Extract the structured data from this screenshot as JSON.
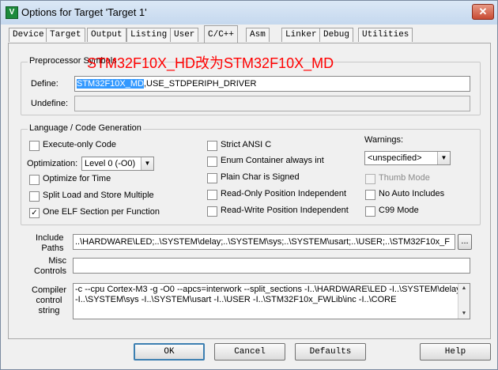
{
  "window": {
    "title": "Options for Target 'Target 1'",
    "app_icon_glyph": "V",
    "close_glyph": "✕"
  },
  "tabs": [
    {
      "label": "Device"
    },
    {
      "label": "Target"
    },
    {
      "label": "Output"
    },
    {
      "label": "Listing"
    },
    {
      "label": "User"
    },
    {
      "label": "C/C++"
    },
    {
      "label": "Asm"
    },
    {
      "label": "Linker"
    },
    {
      "label": "Debug"
    },
    {
      "label": "Utilities"
    }
  ],
  "annotation": "STM32F10X_HD改为STM32F10X_MD",
  "preprocessor": {
    "legend": "Preprocessor Symbols",
    "define_label": "Define:",
    "define_selected": "STM32F10X_MD",
    "define_rest": ",USE_STDPERIPH_DRIVER",
    "undefine_label": "Undefine:",
    "undefine_value": ""
  },
  "language": {
    "legend": "Language / Code Generation",
    "execute_only": {
      "label": "Execute-only Code",
      "checked": false
    },
    "optimization_label": "Optimization:",
    "optimization_value": "Level 0 (-O0)",
    "optimize_time": {
      "label": "Optimize for Time",
      "checked": false
    },
    "split_load": {
      "label": "Split Load and Store Multiple",
      "checked": false
    },
    "one_elf": {
      "label": "One ELF Section per Function",
      "checked": true
    },
    "strict_ansi": {
      "label": "Strict ANSI C",
      "checked": false
    },
    "enum_container": {
      "label": "Enum Container always int",
      "checked": false
    },
    "plain_char": {
      "label": "Plain Char is Signed",
      "checked": false
    },
    "ro_pi": {
      "label": "Read-Only Position Independent",
      "checked": false
    },
    "rw_pi": {
      "label": "Read-Write Position Independent",
      "checked": false
    },
    "warnings_label": "Warnings:",
    "warnings_value": "<unspecified>",
    "thumb_mode": {
      "label": "Thumb Mode",
      "checked": false
    },
    "no_auto_includes": {
      "label": "No Auto Includes",
      "checked": false
    },
    "c99_mode": {
      "label": "C99 Mode",
      "checked": false
    },
    "check_glyph": "✓"
  },
  "include": {
    "label_line1": "Include",
    "label_line2": "Paths",
    "value": "..\\HARDWARE\\LED;..\\SYSTEM\\delay;..\\SYSTEM\\sys;..\\SYSTEM\\usart;..\\USER;..\\STM32F10x_F",
    "browse_label": "..."
  },
  "misc": {
    "label_line1": "Misc",
    "label_line2": "Controls",
    "value": ""
  },
  "compiler": {
    "label_line1": "Compiler",
    "label_line2": "control",
    "label_line3": "string",
    "line1": "-c --cpu Cortex-M3 -g -O0 --apcs=interwork --split_sections -I..\\HARDWARE\\LED -I..\\SYSTEM\\delay",
    "line2": "-I..\\SYSTEM\\sys -I..\\SYSTEM\\usart -I..\\USER -I..\\STM32F10x_FWLib\\inc -I..\\CORE"
  },
  "buttons": {
    "ok": "OK",
    "cancel": "Cancel",
    "defaults": "Defaults",
    "help": "Help"
  },
  "colors": {
    "highlight": "#3399ff",
    "annotation": "#ff0000"
  }
}
